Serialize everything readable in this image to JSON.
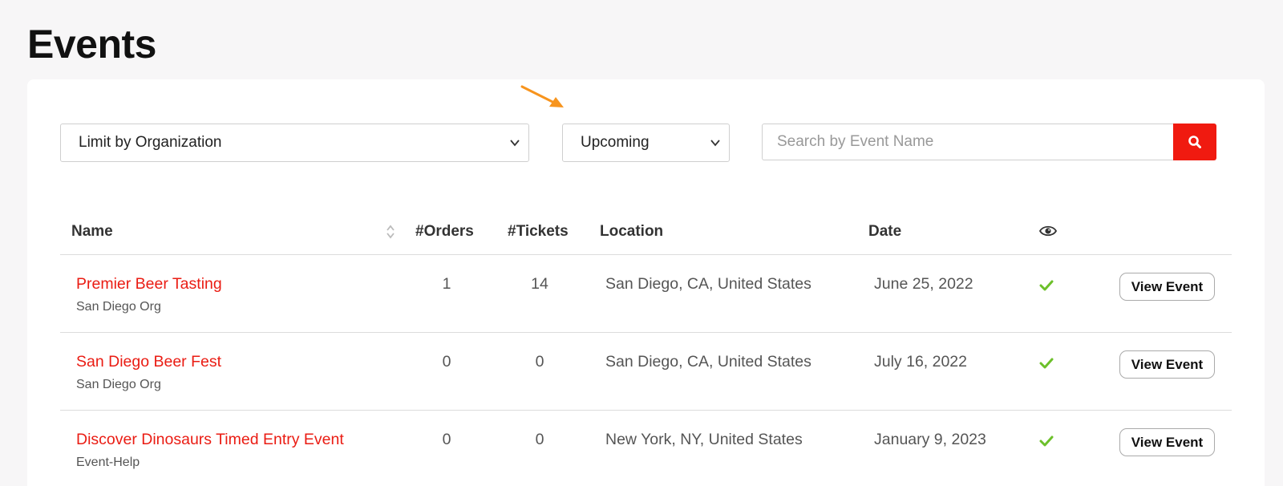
{
  "page": {
    "title": "Events"
  },
  "filters": {
    "organization": {
      "value": "Limit by Organization"
    },
    "status": {
      "value": "Upcoming"
    },
    "search": {
      "placeholder": "Search by Event Name"
    }
  },
  "table": {
    "headers": {
      "name": "Name",
      "orders": "#Orders",
      "tickets": "#Tickets",
      "location": "Location",
      "date": "Date"
    },
    "rows": [
      {
        "name": "Premier Beer Tasting",
        "org": "San Diego Org",
        "orders": "1",
        "tickets": "14",
        "location": "San Diego, CA, United States",
        "date": "June 25, 2022",
        "action": "View Event"
      },
      {
        "name": "San Diego Beer Fest",
        "org": "San Diego Org",
        "orders": "0",
        "tickets": "0",
        "location": "San Diego, CA, United States",
        "date": "July 16, 2022",
        "action": "View Event"
      },
      {
        "name": "Discover Dinosaurs Timed Entry Event",
        "org": "Event-Help",
        "orders": "0",
        "tickets": "0",
        "location": "New York, NY, United States",
        "date": "January 9, 2023",
        "action": "View Event"
      }
    ]
  },
  "icons": {
    "sort": "sort-icon",
    "visibility": "eye-icon",
    "search": "search-icon",
    "published": "checkmark-icon",
    "dropdown": "chevron-down-icon",
    "annotation": "arrow-icon"
  },
  "colors": {
    "accent": "#f01a10",
    "link": "#ea1c13",
    "check": "#6cc02a",
    "annotation_arrow": "#f7941d"
  }
}
